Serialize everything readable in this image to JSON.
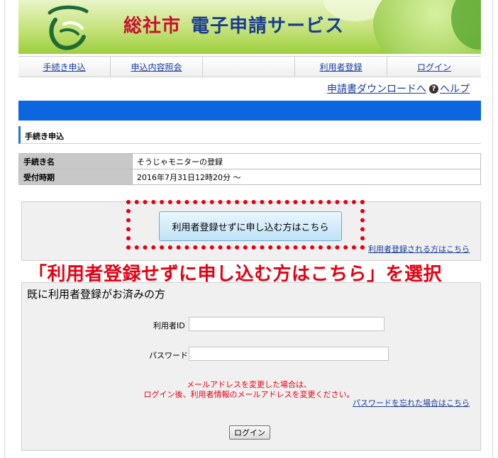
{
  "header": {
    "city_name": "総社市",
    "service_name": "電子申請サービス",
    "logo_icon": "city-emblem-icon"
  },
  "nav": {
    "items": [
      "手続き申込",
      "申込内容照会",
      "",
      "利用者登録",
      "ログイン"
    ]
  },
  "subnav": {
    "download_link": "申請書ダウンロードへ",
    "help_link": "ヘルプ",
    "help_icon": "help-icon"
  },
  "section": {
    "title": "手続き申込"
  },
  "info": {
    "rows": [
      {
        "key": "手続き名",
        "value": "そうじゃモニターの登録"
      },
      {
        "key": "受付時期",
        "value": "2016年7月31日12時20分 ～"
      }
    ]
  },
  "register": {
    "no_register_button": "利用者登録せずに申し込む方はこちら",
    "register_link": "利用者登録される方はこちら"
  },
  "annotation": {
    "text": "「利用者登録せずに申し込む方はこちら」を選択",
    "color": "#e60012"
  },
  "login": {
    "title": "既に利用者登録がお済みの方",
    "user_id_label": "利用者ID",
    "user_id_value": "",
    "password_label": "パスワード",
    "password_value": "",
    "notice_line1": "メールアドレスを変更した場合は、",
    "notice_line2": "ログイン後、利用者情報のメールアドレスを変更ください。",
    "forgot_link": "パスワードを忘れた場合はこちら",
    "login_button": "ログイン"
  },
  "colors": {
    "blue_bar": "#0b66e0",
    "link": "#1a3c9c",
    "alert_red": "#e60012"
  }
}
